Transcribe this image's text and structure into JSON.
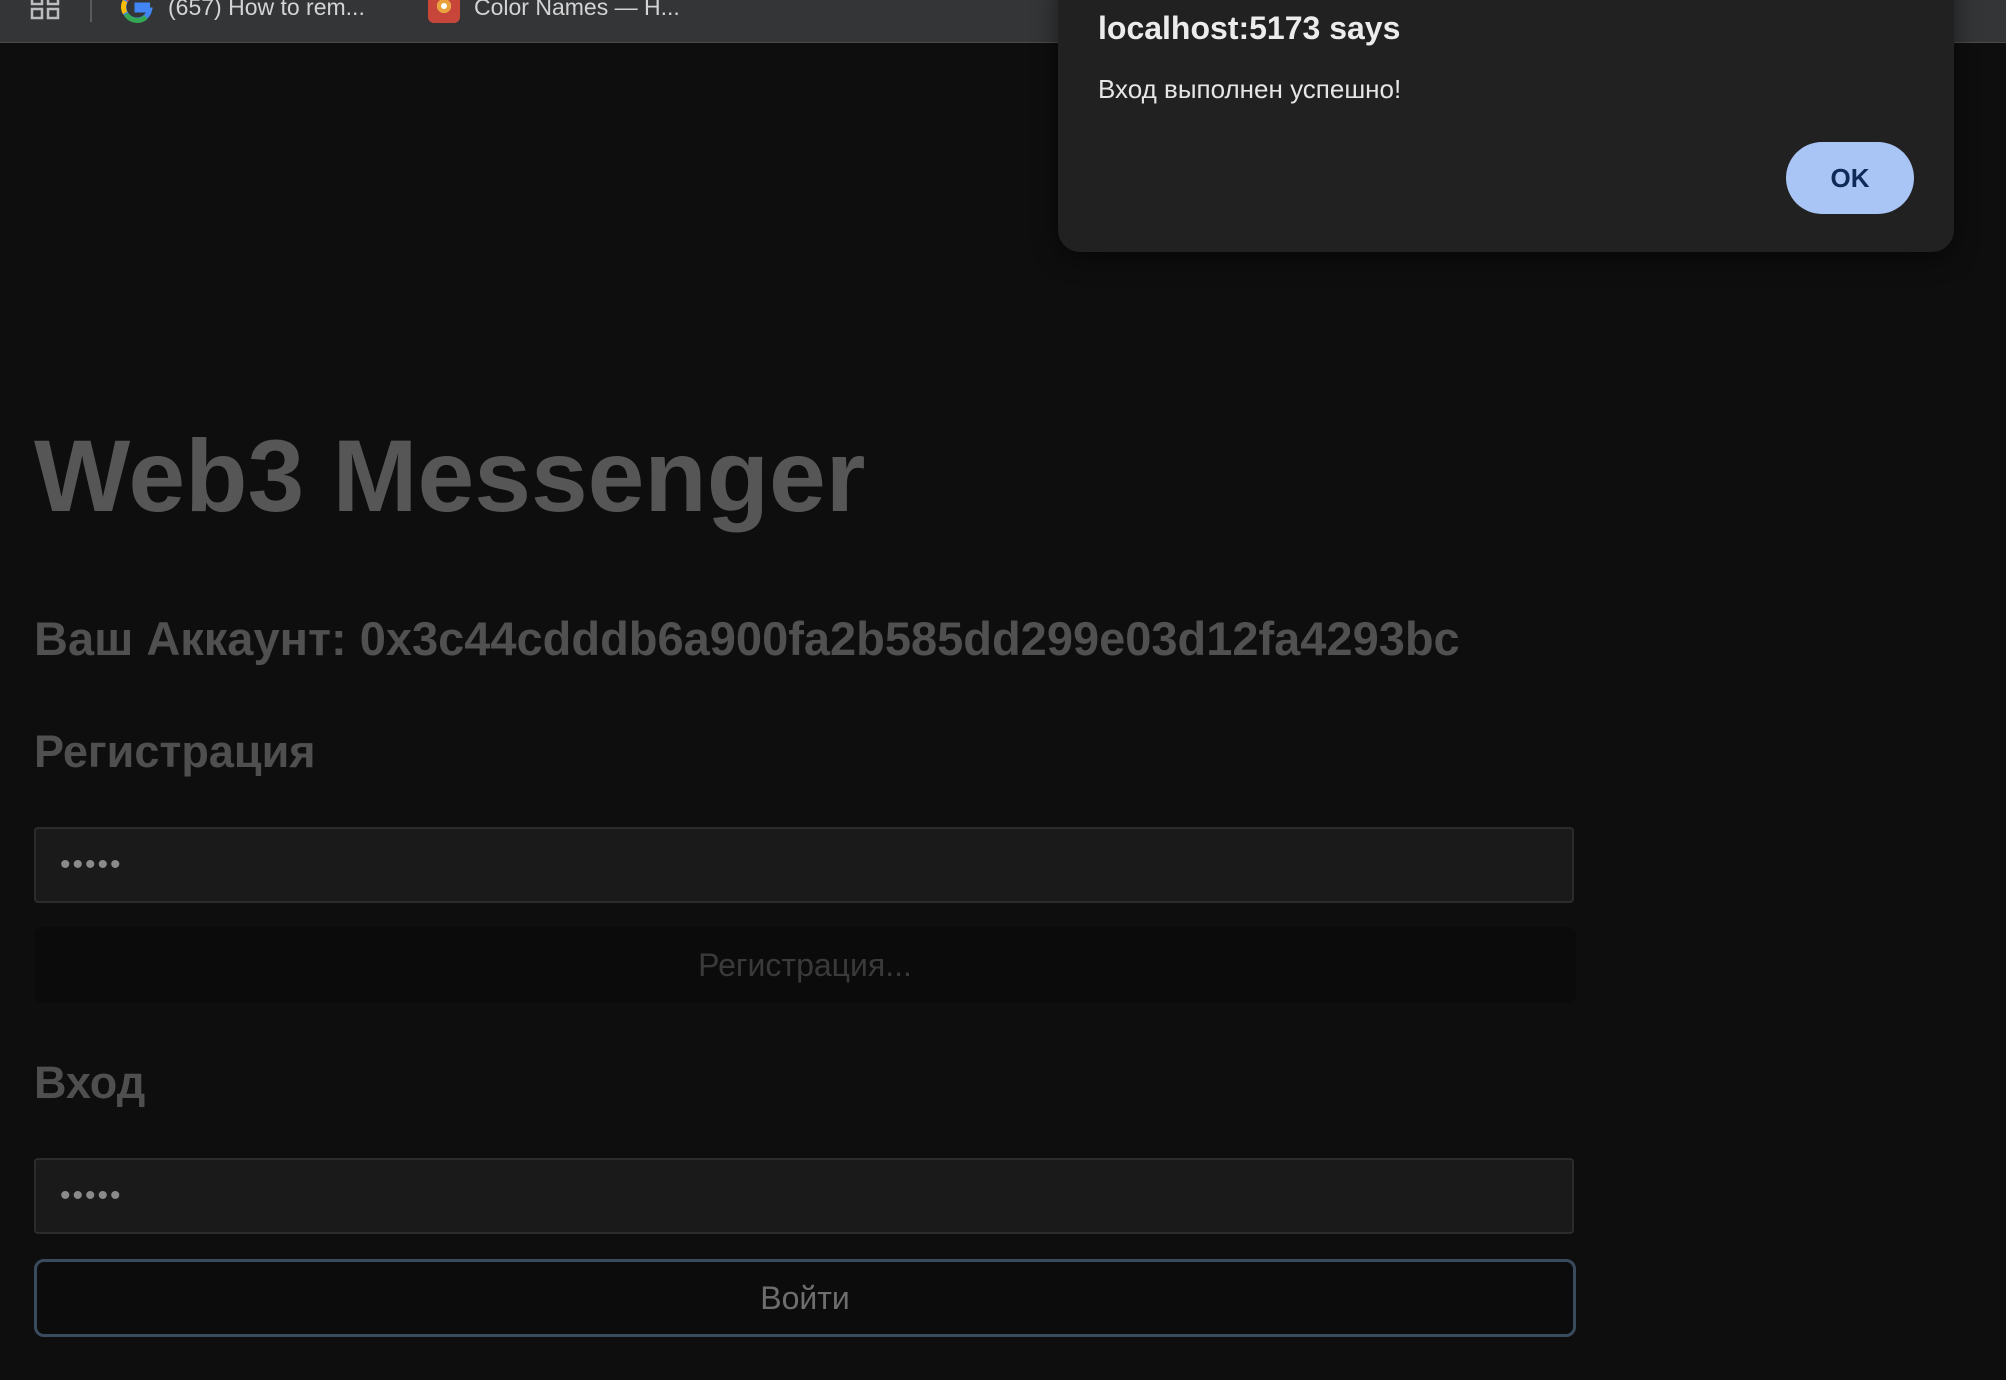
{
  "browser": {
    "bookmarks": [
      {
        "label": "(657) How to rem...",
        "icon": "google-icon"
      },
      {
        "label": "Color Names — H...",
        "icon": "color-names-icon"
      }
    ]
  },
  "dialog": {
    "title": "localhost:5173 says",
    "message": "Вход выполнен успешно!",
    "ok_label": "OK"
  },
  "page": {
    "title": "Web3 Messenger",
    "account": "Ваш Аккаунт: 0x3c44cdddb6a900fa2b585dd299e03d12fa4293bc",
    "register": {
      "heading": "Регистрация",
      "input_value": "•••••",
      "button_label": "Регистрация..."
    },
    "login": {
      "heading": "Вход",
      "input_value": "•••••",
      "button_label": "Войти"
    }
  },
  "colors": {
    "background": "#0e0e0f",
    "dialog_bg": "#212122",
    "ok_button": "#a8c5f5",
    "login_border": "#3a4b5e"
  }
}
